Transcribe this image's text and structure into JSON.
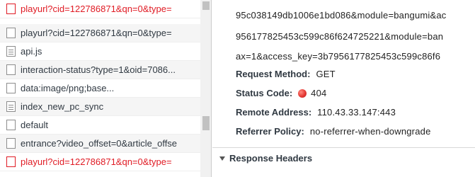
{
  "requests": [
    {
      "name": "playurl?cid=122786871&qn=0&type=",
      "icon": "checkbox-icon",
      "status": "error"
    },
    {
      "name": "playurl?cid=122786871&qn=0&type=",
      "icon": "checkbox-icon",
      "status": "ok"
    },
    {
      "name": "api.js",
      "icon": "document-icon",
      "status": "ok"
    },
    {
      "name": "interaction-status?type=1&oid=7086...",
      "icon": "checkbox-icon",
      "status": "ok"
    },
    {
      "name": "data:image/png;base...",
      "icon": "checkbox-icon",
      "status": "ok"
    },
    {
      "name": "index_new_pc_sync",
      "icon": "document-icon",
      "status": "ok"
    },
    {
      "name": "default",
      "icon": "checkbox-icon",
      "status": "ok"
    },
    {
      "name": "entrance?video_offset=0&article_offse",
      "icon": "checkbox-icon",
      "status": "ok"
    },
    {
      "name": "playurl?cid=122786871&qn=0&type=",
      "icon": "checkbox-icon",
      "status": "error"
    }
  ],
  "headers": {
    "url_lines": [
      "95c038149db1006e1bd086&module=bangumi&ac",
      "956177825453c599c86f624725221&module=ban",
      "ax=1&access_key=3b7956177825453c599c86f6"
    ],
    "request_method_key": "Request Method:",
    "request_method_value": "GET",
    "status_code_key": "Status Code:",
    "status_code_value": "404",
    "remote_address_key": "Remote Address:",
    "remote_address_value": "110.43.33.147:443",
    "referrer_policy_key": "Referrer Policy:",
    "referrer_policy_value": "no-referrer-when-downgrade",
    "response_headers_title": "Response Headers"
  },
  "colors": {
    "error": "#e01b24",
    "status_dot": "#e53935"
  }
}
